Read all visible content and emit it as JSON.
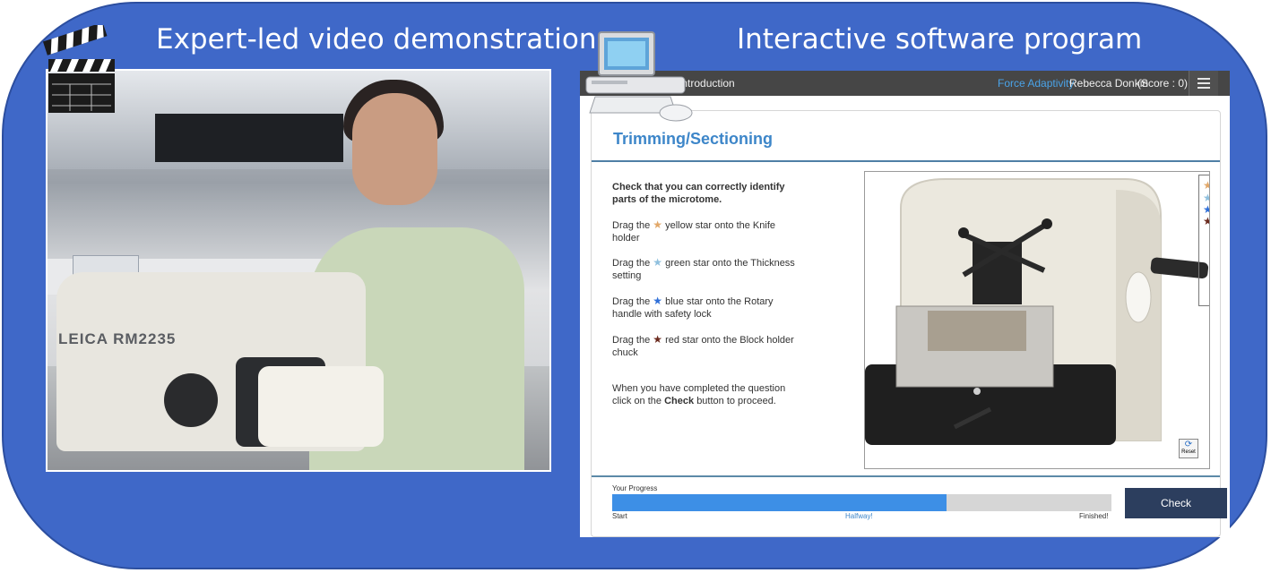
{
  "headings": {
    "left": "Expert-led video demonstration",
    "right": "Interactive software program"
  },
  "video": {
    "machine_label": "LEICA RM2235"
  },
  "app": {
    "topbar": {
      "title": "odule - Introduction",
      "force_adaptivity": "Force Adaptivity",
      "user": "Rebecca Donkin",
      "score": "(Score : 0)"
    },
    "card_title": "Trimming/Sectioning",
    "instructions": {
      "intro": "Check that you can correctly identify parts of the microtome.",
      "items": [
        {
          "pre": "Drag the",
          "star_color": "#e2a869",
          "post": "yellow star onto the Knife holder"
        },
        {
          "pre": "Drag the",
          "star_color": "#8fc0de",
          "post": "green star onto the Thickness setting"
        },
        {
          "pre": "Drag the",
          "star_color": "#2f6fd8",
          "post": "blue star onto the Rotary handle with safety lock"
        },
        {
          "pre": "Drag the",
          "star_color": "#6b2a1e",
          "post": "red star onto the  Block holder chuck"
        }
      ],
      "closing_pre": "When you have completed the question click on the",
      "closing_bold": "Check",
      "closing_post": "button to proceed."
    },
    "tray_star_colors": [
      "#e2a869",
      "#8fc0de",
      "#2f6fd8",
      "#6b2a1e"
    ],
    "reset_label": "Reset",
    "progress": {
      "label": "Your Progress",
      "fraction": 0.67,
      "start": "Start",
      "halfway": "Halfway!",
      "finished": "Finished!"
    },
    "check_label": "Check"
  },
  "colors": {
    "background_blue": "#3f68c8",
    "topbar": "#464646",
    "accent": "#3d86c9",
    "progress_fill": "#3d8fe6",
    "check_button": "#2c3e5e"
  }
}
